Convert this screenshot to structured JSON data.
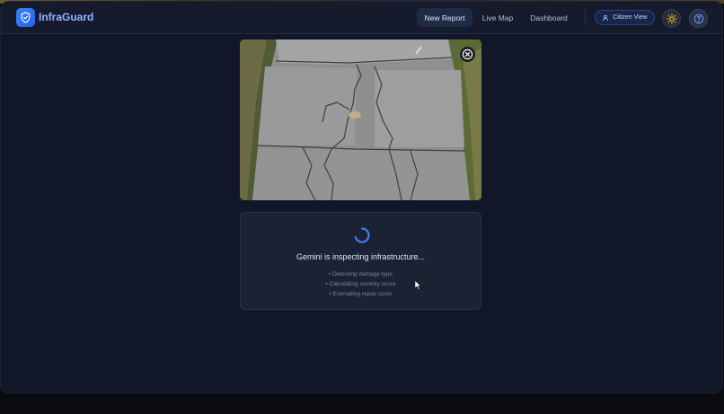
{
  "app": {
    "name": "InfraGuard"
  },
  "nav": {
    "items": [
      {
        "label": "New Report",
        "active": true
      },
      {
        "label": "Live Map",
        "active": false
      },
      {
        "label": "Dashboard",
        "active": false
      }
    ],
    "citizen_view_label": "Citizen View"
  },
  "icons": {
    "logo": "shield-check-icon",
    "theme_toggle": "sun-icon",
    "help": "help-circle-icon",
    "citizen": "user-icon",
    "close": "close-circle-icon"
  },
  "colors": {
    "accent": "#3b82f6",
    "background": "#111628",
    "card": "#1a2234",
    "sun": "#f5b73b"
  },
  "analysis": {
    "status": "Gemini is inspecting infrastructure...",
    "steps": [
      "• Detecting damage type",
      "• Calculating severity score",
      "• Estimating repair costs"
    ]
  }
}
